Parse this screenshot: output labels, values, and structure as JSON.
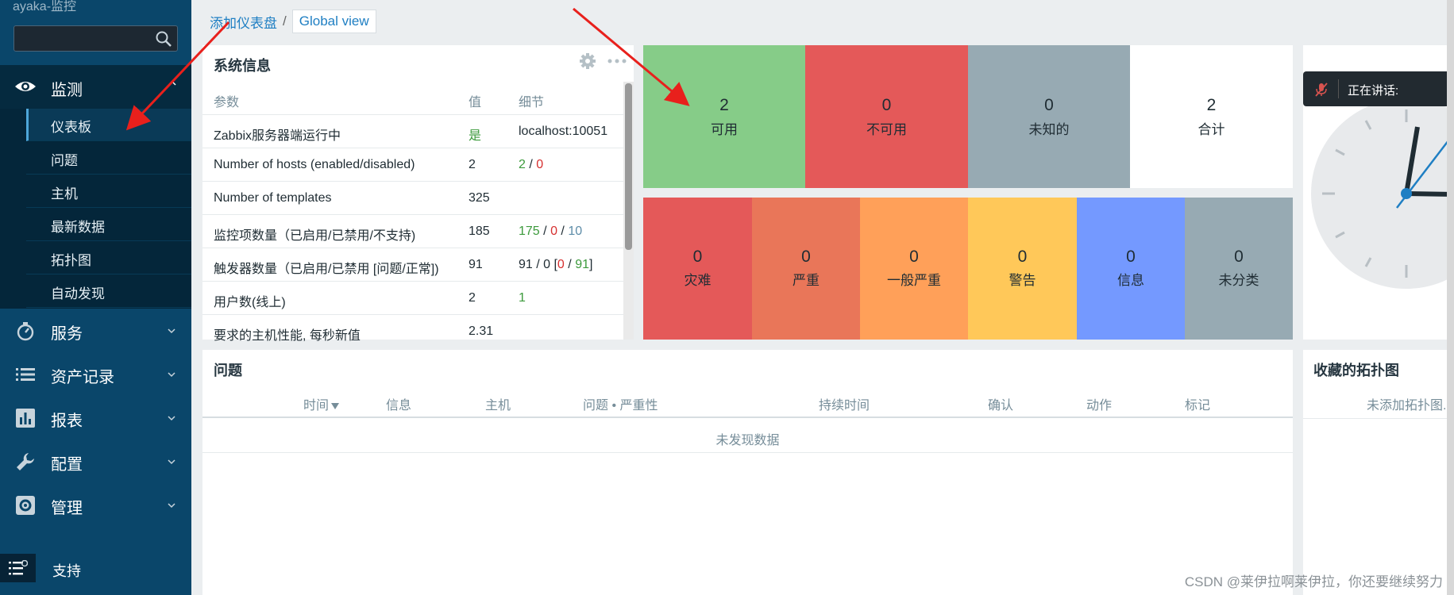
{
  "sidebar": {
    "brand": "ayaka-监控",
    "search_placeholder": "",
    "monitor": {
      "label": "监测",
      "icon": "eye-icon"
    },
    "submenu": [
      "仪表板",
      "问题",
      "主机",
      "最新数据",
      "拓扑图",
      "自动发现"
    ],
    "items": [
      {
        "label": "服务",
        "icon": "stopwatch-icon"
      },
      {
        "label": "资产记录",
        "icon": "list-icon"
      },
      {
        "label": "报表",
        "icon": "bar-chart-icon"
      },
      {
        "label": "配置",
        "icon": "wrench-icon"
      },
      {
        "label": "管理",
        "icon": "gear-icon"
      }
    ],
    "support": "支持"
  },
  "breadcrumb": {
    "first": "添加仪表盘",
    "sep": "/",
    "second": "Global view"
  },
  "sysinfo": {
    "title": "系统信息",
    "headers": [
      "参数",
      "值",
      "细节"
    ],
    "rows": [
      {
        "param": "Zabbix服务器端运行中",
        "value": "是",
        "detail": "localhost:10051"
      },
      {
        "param": "Number of hosts (enabled/disabled)",
        "value": "2",
        "detail_a": "2",
        "detail_sep": "/",
        "detail_b": "0"
      },
      {
        "param": "Number of templates",
        "value": "325"
      },
      {
        "param": "监控项数量（已启用/已禁用/不支持)",
        "value": "185",
        "detail_a": "175",
        "detail_b": "0",
        "detail_c": "10",
        "detail_sep": "/"
      },
      {
        "param": "触发器数量（已启用/已禁用 [问题/正常])",
        "value": "91",
        "detail_pre": "91 / 0 [",
        "detail_a": "0",
        "detail_sep": "/",
        "detail_b": "91",
        "detail_post": "]"
      },
      {
        "param": "用户数(线上)",
        "value": "2",
        "detail_a": "1"
      },
      {
        "param": "要求的主机性能, 每秒新值",
        "value": "2.31"
      }
    ]
  },
  "hosts": [
    {
      "count": "2",
      "label": "可用",
      "color": "#86cc88"
    },
    {
      "count": "0",
      "label": "不可用",
      "color": "#e45959"
    },
    {
      "count": "0",
      "label": "未知的",
      "color": "#97aab3"
    },
    {
      "count": "2",
      "label": "合计",
      "color": "#ffffff"
    }
  ],
  "severity": [
    {
      "count": "0",
      "label": "灾难",
      "color": "#e45959"
    },
    {
      "count": "0",
      "label": "严重",
      "color": "#e97659"
    },
    {
      "count": "0",
      "label": "一般严重",
      "color": "#ffa059"
    },
    {
      "count": "0",
      "label": "警告",
      "color": "#ffc859"
    },
    {
      "count": "0",
      "label": "信息",
      "color": "#7499ff"
    },
    {
      "count": "0",
      "label": "未分类",
      "color": "#97aab3"
    }
  ],
  "talk": {
    "label": "正在讲话:"
  },
  "problems": {
    "title": "问题",
    "headers": [
      "时间",
      "信息",
      "主机",
      "问题 • 严重性",
      "持续时间",
      "确认",
      "动作",
      "标记"
    ],
    "empty": "未发现数据"
  },
  "maps": {
    "title": "收藏的拓扑图",
    "empty": "未添加拓扑图."
  },
  "watermark": "CSDN @莱伊拉啊莱伊拉，你还要继续努力"
}
